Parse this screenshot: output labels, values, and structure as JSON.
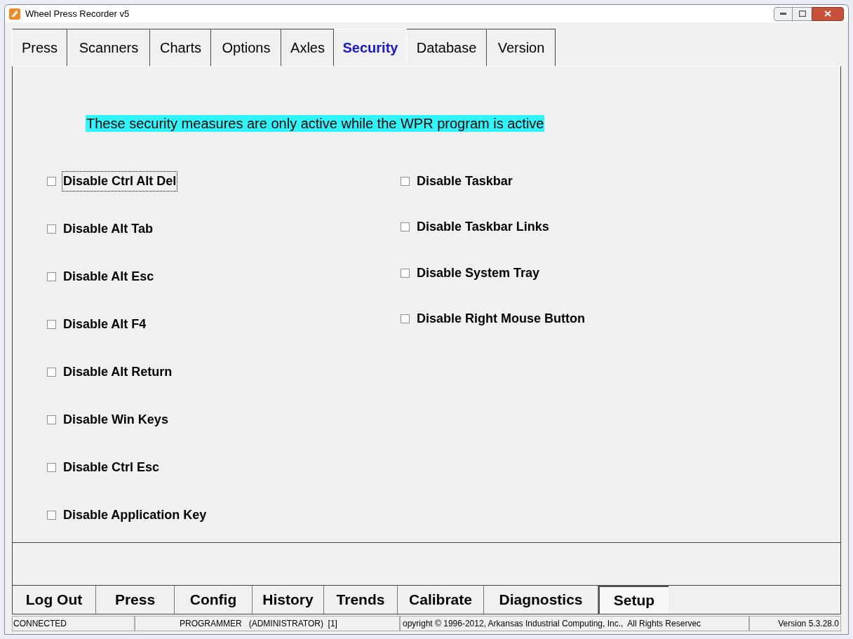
{
  "window": {
    "title": "Wheel Press Recorder v5"
  },
  "tabs": [
    {
      "label": "Press",
      "selected": false
    },
    {
      "label": "Scanners",
      "selected": false
    },
    {
      "label": "Charts",
      "selected": false
    },
    {
      "label": "Options",
      "selected": false
    },
    {
      "label": "Axles",
      "selected": false
    },
    {
      "label": "Security",
      "selected": true
    },
    {
      "label": "Database",
      "selected": false
    },
    {
      "label": "Version",
      "selected": false
    }
  ],
  "notice": "These security measures are only active while the WPR program is active",
  "left_options": [
    {
      "label": "Disable Ctrl Alt Del",
      "checked": false,
      "focused": true
    },
    {
      "label": "Disable Alt Tab",
      "checked": false,
      "focused": false
    },
    {
      "label": "Disable Alt Esc",
      "checked": false,
      "focused": false
    },
    {
      "label": "Disable Alt F4",
      "checked": false,
      "focused": false
    },
    {
      "label": "Disable Alt Return",
      "checked": false,
      "focused": false
    },
    {
      "label": "Disable Win Keys",
      "checked": false,
      "focused": false
    },
    {
      "label": "Disable Ctrl Esc",
      "checked": false,
      "focused": false
    },
    {
      "label": "Disable Application Key",
      "checked": false,
      "focused": false
    }
  ],
  "right_options": [
    {
      "label": "Disable Taskbar",
      "checked": false,
      "focused": false
    },
    {
      "label": "Disable Taskbar Links",
      "checked": false,
      "focused": false
    },
    {
      "label": "Disable System Tray",
      "checked": false,
      "focused": false
    },
    {
      "label": "Disable Right Mouse Button",
      "checked": false,
      "focused": false
    }
  ],
  "nav_buttons": [
    {
      "label": "Log Out",
      "selected": false
    },
    {
      "label": "Press",
      "selected": false
    },
    {
      "label": "Config",
      "selected": false
    },
    {
      "label": "History",
      "selected": false
    },
    {
      "label": "Trends",
      "selected": false
    },
    {
      "label": "Calibrate",
      "selected": false
    },
    {
      "label": "Diagnostics",
      "selected": false
    },
    {
      "label": "Setup",
      "selected": true
    }
  ],
  "status_bar": {
    "connection": "CONNECTED",
    "user": "PROGRAMMER   (ADMINISTRATOR)  [1]",
    "copyright": "opyright © 1996-2012, Arkansas Industrial Computing, Inc.,  All Rights Reservec",
    "version": "Version 5.3.28.0"
  }
}
